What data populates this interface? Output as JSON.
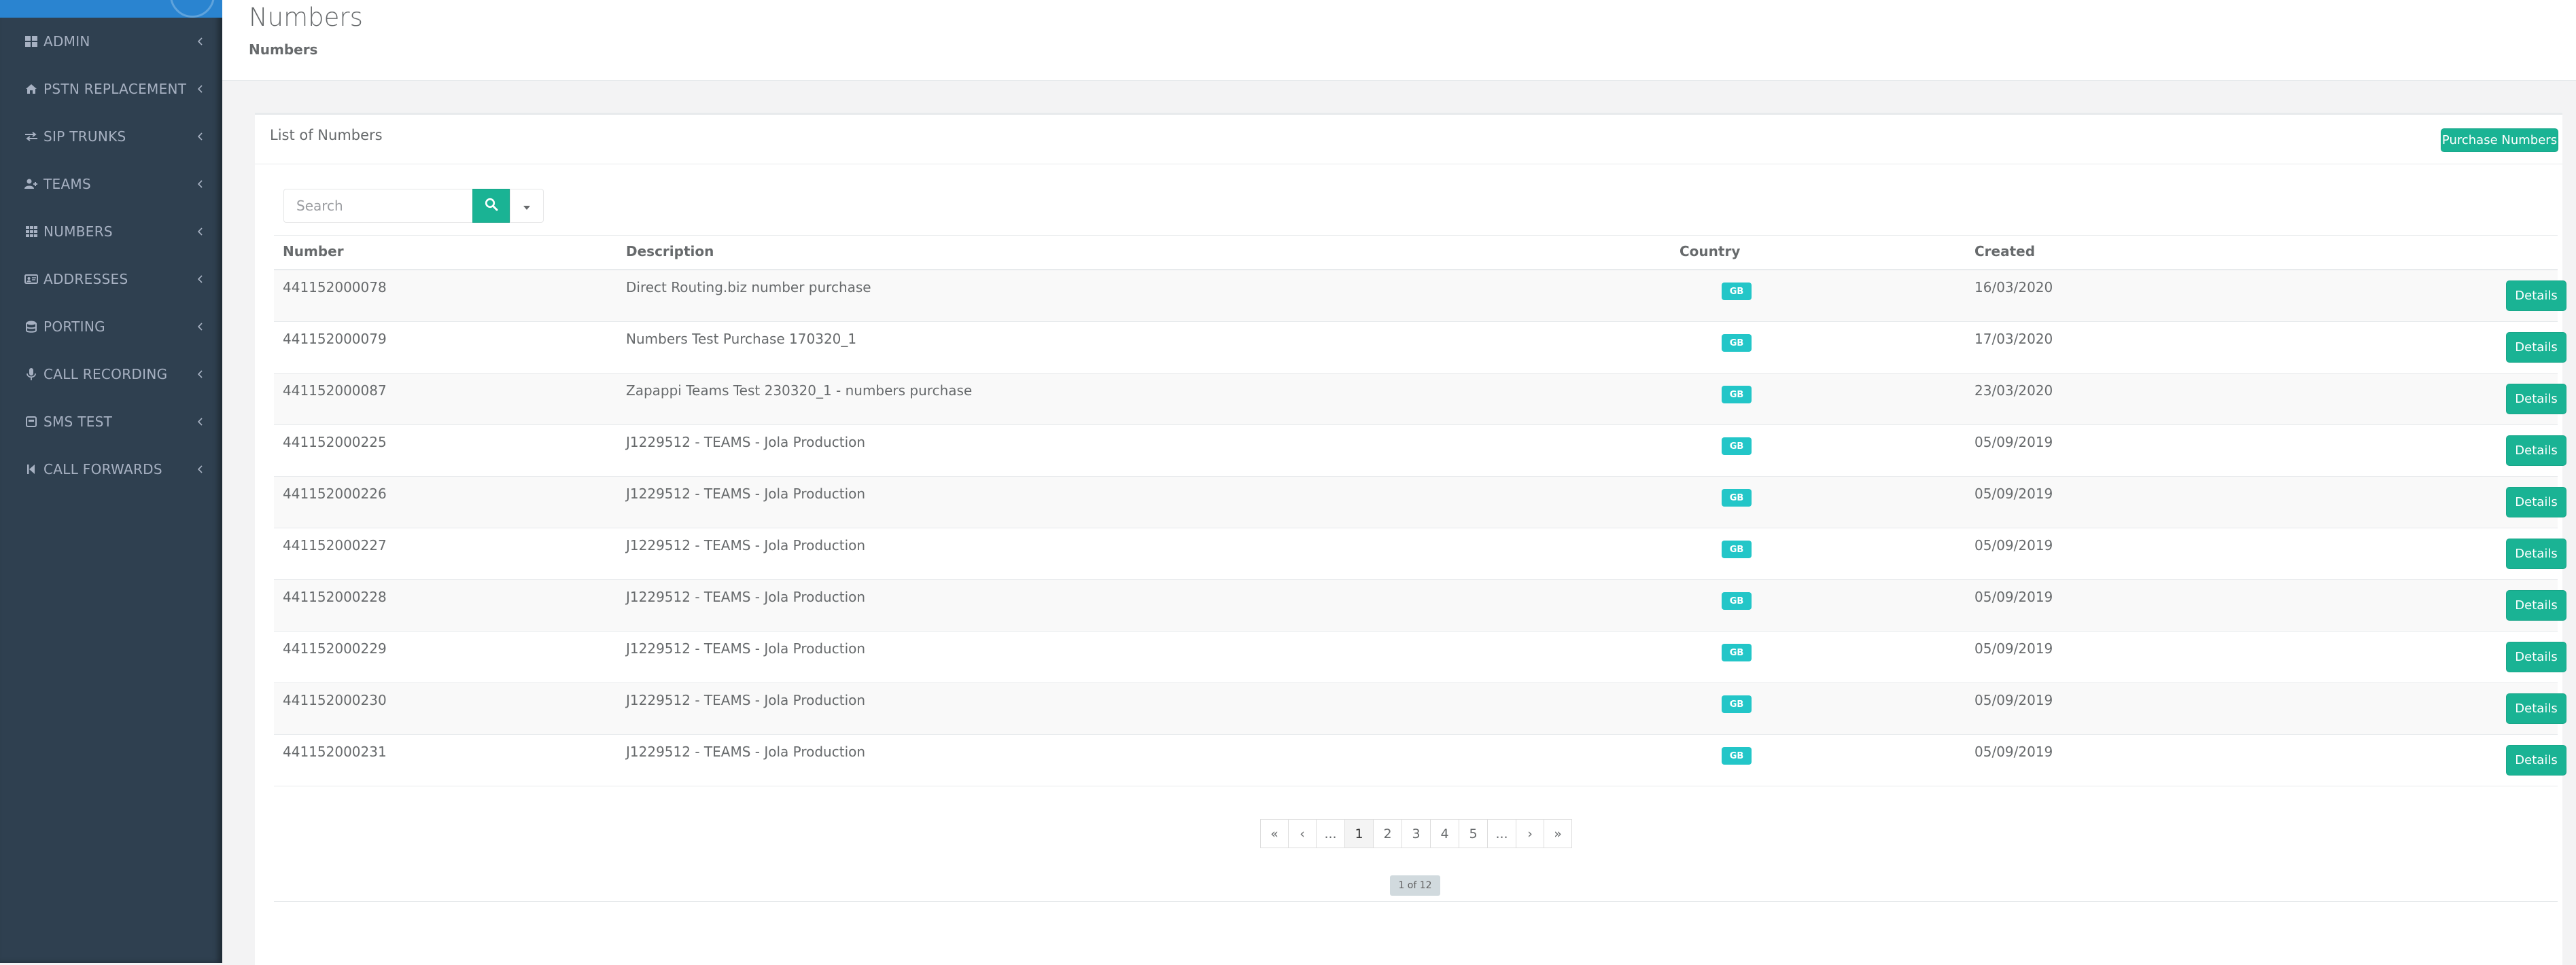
{
  "sidebar": {
    "items": [
      {
        "label": "ADMIN",
        "icon": "dashboard-grid-icon"
      },
      {
        "label": "PSTN REPLACEMENT",
        "icon": "home-icon"
      },
      {
        "label": "SIP TRUNKS",
        "icon": "exchange-arrows-icon"
      },
      {
        "label": "TEAMS",
        "icon": "user-plus-icon"
      },
      {
        "label": "NUMBERS",
        "icon": "th-grid-icon"
      },
      {
        "label": "ADDRESSES",
        "icon": "address-card-icon"
      },
      {
        "label": "PORTING",
        "icon": "database-icon"
      },
      {
        "label": "CALL RECORDING",
        "icon": "microphone-icon"
      },
      {
        "label": "SMS TEST",
        "icon": "sms-box-icon"
      },
      {
        "label": "CALL FORWARDS",
        "icon": "step-forward-icon"
      }
    ]
  },
  "header": {
    "title": "Numbers",
    "breadcrumb": "Numbers"
  },
  "panel": {
    "title": "List of Numbers",
    "purchase_label": "Purchase Numbers"
  },
  "search": {
    "placeholder": "Search",
    "value": ""
  },
  "table": {
    "columns": [
      "Number",
      "Description",
      "Country",
      "Created"
    ],
    "rows": [
      {
        "number": "441152000078",
        "description": "Direct Routing.biz number purchase",
        "country": "GB",
        "created": "16/03/2020",
        "action": "Details"
      },
      {
        "number": "441152000079",
        "description": "Numbers Test Purchase 170320_1",
        "country": "GB",
        "created": "17/03/2020",
        "action": "Details"
      },
      {
        "number": "441152000087",
        "description": "Zapappi Teams Test 230320_1 - numbers purchase",
        "country": "GB",
        "created": "23/03/2020",
        "action": "Details"
      },
      {
        "number": "441152000225",
        "description": "J1229512 - TEAMS - Jola Production",
        "country": "GB",
        "created": "05/09/2019",
        "action": "Details"
      },
      {
        "number": "441152000226",
        "description": "J1229512 - TEAMS - Jola Production",
        "country": "GB",
        "created": "05/09/2019",
        "action": "Details"
      },
      {
        "number": "441152000227",
        "description": "J1229512 - TEAMS - Jola Production",
        "country": "GB",
        "created": "05/09/2019",
        "action": "Details"
      },
      {
        "number": "441152000228",
        "description": "J1229512 - TEAMS - Jola Production",
        "country": "GB",
        "created": "05/09/2019",
        "action": "Details"
      },
      {
        "number": "441152000229",
        "description": "J1229512 - TEAMS - Jola Production",
        "country": "GB",
        "created": "05/09/2019",
        "action": "Details"
      },
      {
        "number": "441152000230",
        "description": "J1229512 - TEAMS - Jola Production",
        "country": "GB",
        "created": "05/09/2019",
        "action": "Details"
      },
      {
        "number": "441152000231",
        "description": "J1229512 - TEAMS - Jola Production",
        "country": "GB",
        "created": "05/09/2019",
        "action": "Details"
      }
    ]
  },
  "pagination": {
    "items": [
      "«",
      "‹",
      "...",
      "1",
      "2",
      "3",
      "4",
      "5",
      "...",
      "›",
      "»"
    ],
    "active_page": "1",
    "summary": "1 of 12"
  },
  "colors": {
    "sidebar_bg": "#2f4050",
    "sidebar_text": "#a7b1c2",
    "primary": "#1ab394",
    "info_badge": "#23c6c8"
  }
}
